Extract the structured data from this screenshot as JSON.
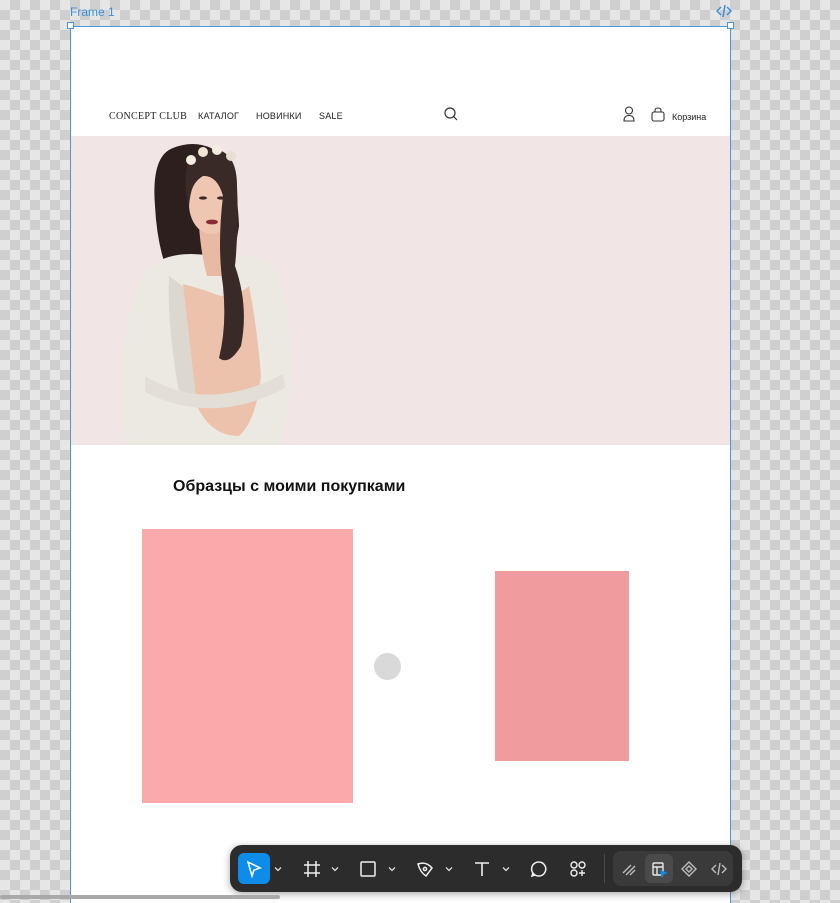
{
  "canvas": {
    "frame_label": "Frame 1"
  },
  "site": {
    "logo": "CONCEPT CLUB",
    "nav": [
      "КАТАЛОГ",
      "НОВИНКИ",
      "SALE"
    ],
    "cart_label": "Корзина",
    "section_title": "Образцы с моими покупками"
  },
  "colors": {
    "hero_bg": "#f2e5e6",
    "card_1": "#fbaaab",
    "card_2": "#f09c9e",
    "accent": "#0d8ce9"
  },
  "toolbar": {
    "tools": [
      "move-tool",
      "frame-tool",
      "shape-tool",
      "pen-tool",
      "text-tool",
      "comment-tool",
      "actions-tool"
    ],
    "modes": [
      "draw-mode",
      "design-mode",
      "prototype-mode",
      "dev-mode"
    ],
    "active_tool": "move-tool",
    "active_mode": "design-mode"
  }
}
